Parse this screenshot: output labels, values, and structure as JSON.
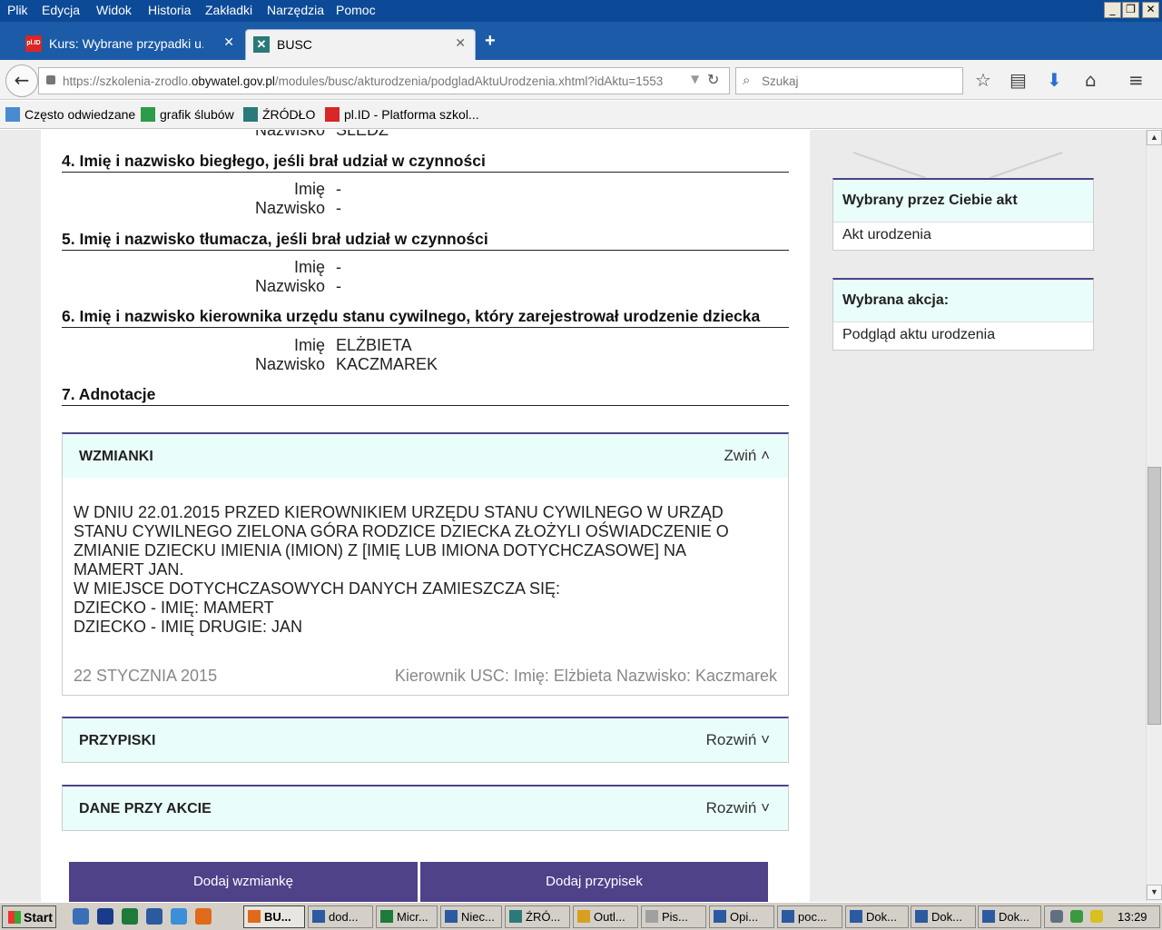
{
  "menu": [
    "Plik",
    "Edycja",
    "Widok",
    "Historia",
    "Zakładki",
    "Narzędzia",
    "Pomoc"
  ],
  "window_controls": {
    "minimize": "_",
    "restore": "❐",
    "close": "✕"
  },
  "tabs": [
    {
      "favicon": "pl.ID",
      "label": "Kurs: Wybrane przypadki u...",
      "close": "✕"
    },
    {
      "favicon": "✕",
      "label": "BUSC",
      "close": "✕"
    }
  ],
  "new_tab": "+",
  "nav": {
    "back": "←",
    "url_prefix": "https://szkolenia-zrodlo.",
    "url_domain": "obywatel.gov.pl",
    "url_suffix": "/modules/busc/akturodzenia/podgladAktuUrodzenia.xhtml?idAktu=1553",
    "dropdown": "▼",
    "reload": "↻",
    "search_placeholder": "Szukaj",
    "search_icon": "⌕",
    "icons": {
      "bookmark": "☆",
      "reading_list": "▤",
      "download": "⬇",
      "home": "⌂",
      "menu": "≡"
    }
  },
  "bookmarks": [
    {
      "label": "Często odwiedzane"
    },
    {
      "label": "grafik ślubów"
    },
    {
      "label": "ŹRÓDŁO"
    },
    {
      "label": "pl.ID - Platforma szkol..."
    }
  ],
  "sections": [
    {
      "partial_label": "Nazwisko",
      "partial_value": "ŚLEDŹ"
    },
    {
      "title": "4. Imię i nazwisko biegłego, jeśli brał udział w czynności",
      "rows": [
        {
          "label": "Imię",
          "value": "-"
        },
        {
          "label": "Nazwisko",
          "value": "-"
        }
      ]
    },
    {
      "title": "5. Imię i nazwisko tłumacza, jeśli brał udział w czynności",
      "rows": [
        {
          "label": "Imię",
          "value": "-"
        },
        {
          "label": "Nazwisko",
          "value": "-"
        }
      ]
    },
    {
      "title": "6. Imię i nazwisko kierownika urzędu stanu cywilnego, który zarejestrował urodzenie dziecka",
      "rows": [
        {
          "label": "Imię",
          "value": "ELŻBIETA"
        },
        {
          "label": "Nazwisko",
          "value": "KACZMAREK"
        }
      ]
    },
    {
      "title": "7. Adnotacje"
    }
  ],
  "wzmianki": {
    "title": "WZMIANKI",
    "toggle": "Zwiń ˄",
    "lines": [
      "W DNIU 22.01.2015 PRZED KIEROWNIKIEM URZĘDU STANU CYWILNEGO W URZĄD",
      "STANU CYWILNEGO ZIELONA GÓRA RODZICE DZIECKA ZŁOŻYLI OŚWIADCZENIE O",
      "ZMIANIE DZIECKU IMIENIA (IMION) Z [IMIĘ LUB IMIONA DOTYCHCZASOWE] NA",
      "MAMERT JAN.",
      "W MIEJSCE DOTYCHCZASOWYCH DANYCH ZAMIESZCZA SIĘ:",
      "DZIECKO - IMIĘ: MAMERT",
      "DZIECKO - IMIĘ DRUGIE: JAN"
    ],
    "date": "22 STYCZNIA 2015",
    "signature": "Kierownik USC: Imię: Elżbieta Nazwisko: Kaczmarek"
  },
  "przypiski": {
    "title": "PRZYPISKI",
    "toggle": "Rozwiń ˅"
  },
  "dane_przy_akcie": {
    "title": "DANE PRZY AKCIE",
    "toggle": "Rozwiń ˅"
  },
  "buttons": {
    "add_wzmianka": "Dodaj wzmiankę",
    "add_przypisek": "Dodaj przypisek"
  },
  "sidebar": {
    "akt_title": "Wybrany przez Ciebie akt",
    "akt_value": "Akt urodzenia",
    "akcja_title": "Wybrana akcja:",
    "akcja_value": "Podgląd aktu urodzenia"
  },
  "taskbar": {
    "start": "Start",
    "items": [
      "BU...",
      "dod...",
      "Micr...",
      "Niec...",
      "ŹRÓ...",
      "Outl...",
      "Pis...",
      "Opi...",
      "poc...",
      "Dok...",
      "Dok...",
      "Dok..."
    ],
    "clock": "13:29"
  }
}
